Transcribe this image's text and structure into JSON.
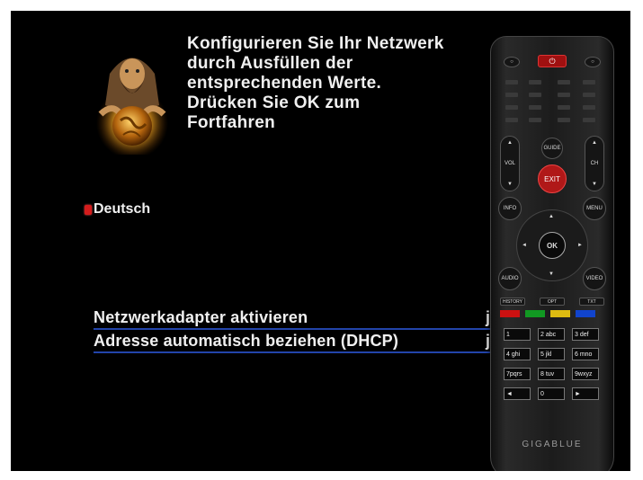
{
  "intro_text": "Konfigurieren Sie Ihr Netzwerk\ndurch Ausfüllen der\nentsprechenden Werte.\nDrücken Sie OK zum\nFortfahren",
  "language": "Deutsch",
  "settings": [
    {
      "label": "Netzwerkadapter aktivieren",
      "value": "j"
    },
    {
      "label": "Adresse automatisch beziehen (DHCP)",
      "value": "j"
    }
  ],
  "remote": {
    "guide": "GUIDE",
    "exit": "EXIT",
    "info": "INFO",
    "menu": "MENU",
    "ok": "OK",
    "audio": "AUDIO",
    "video": "VIDEO",
    "history": "HISTORY",
    "opt": "OPT",
    "txt": "TXT",
    "vol": "VOL",
    "ch": "CH",
    "keys": [
      "1",
      "2 abc",
      "3 def",
      "4 ghi",
      "5 jkl",
      "6 mno",
      "7pqrs",
      "8 tuv",
      "9wxyz",
      "◄",
      "0",
      "►"
    ],
    "brand": "GIGABLUE",
    "colors": [
      "#cc1111",
      "#119922",
      "#ddbb11",
      "#1144cc"
    ]
  }
}
